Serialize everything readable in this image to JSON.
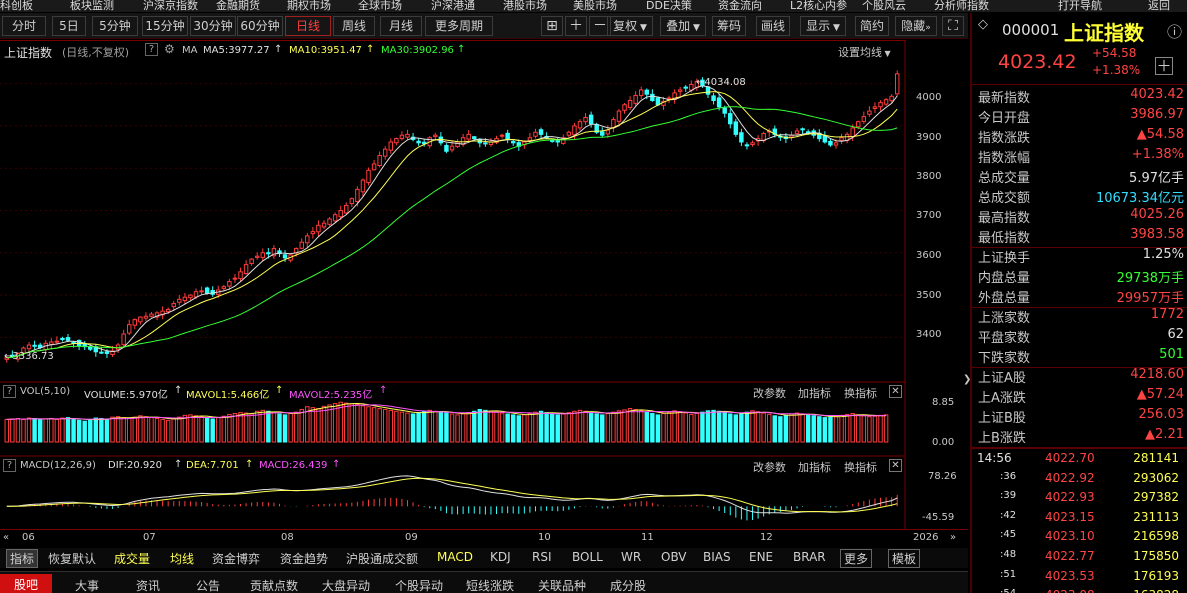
{
  "top_menu": [
    "科创板",
    "板块监测",
    "沪深京指数",
    "金融期货",
    "期权市场",
    "全球市场",
    "沪深港通",
    "港股市场",
    "美股市场",
    "DDE决策",
    "资金流向",
    "L2核心内参",
    "个股风云",
    "分析师指数",
    "打开导航",
    "返回"
  ],
  "toolbar": {
    "periods": [
      "分时",
      "5日",
      "5分钟",
      "15分钟",
      "30分钟",
      "60分钟",
      "日线",
      "周线",
      "月线",
      "更多周期"
    ],
    "selected_period": "日线",
    "actions": [
      "复权",
      "叠加",
      "筹码",
      "画线",
      "显示",
      "简约",
      "隐藏"
    ]
  },
  "chart_header": {
    "title": "上证指数",
    "subtitle": "(日线,不复权)",
    "ma_label": "MA",
    "ma5": "MA5:3977.27",
    "ma10": "MA10:3951.47",
    "ma30": "MA30:3902.96",
    "set_ma": "设置均线"
  },
  "annotations": {
    "high": "4034.08",
    "low": "3336.73"
  },
  "vol_header": {
    "name": "VOL(5,10)",
    "volume": "VOLUME:5.970亿",
    "mavol1": "MAVOL1:5.466亿",
    "mavol2": "MAVOL2:5.235亿",
    "btn1": "改参数",
    "btn2": "加指标",
    "btn3": "换指标"
  },
  "macd_header": {
    "name": "MACD(12,26,9)",
    "dif": "DIF:20.920",
    "dea": "DEA:7.701",
    "macd": "MACD:26.439",
    "btn1": "改参数",
    "btn2": "加指标",
    "btn3": "换指标"
  },
  "x_axis": [
    "06",
    "07",
    "08",
    "09",
    "10",
    "11",
    "12",
    "2026"
  ],
  "indicator_tabs": [
    "指标",
    "恢复默认",
    "成交量",
    "均线",
    "资金博弈",
    "资金趋势",
    "沪股通成交额",
    "MACD",
    "KDJ",
    "RSI",
    "BOLL",
    "WR",
    "OBV",
    "BIAS",
    "ENE",
    "BRAR",
    "更多",
    "模板"
  ],
  "bottom_tabs": [
    "股吧",
    "大事",
    "资讯",
    "公告",
    "贡献点数",
    "大盘异动",
    "个股异动",
    "短线涨跌",
    "关联品种",
    "成分股"
  ],
  "quote": {
    "code": "000001",
    "name": "上证指数",
    "price": "4023.42",
    "change": "+54.58",
    "change_pct": "+1.38%",
    "rows": [
      {
        "k": "最新指数",
        "v": "4023.42",
        "c": "red"
      },
      {
        "k": "今日开盘",
        "v": "3986.97",
        "c": "red"
      },
      {
        "k": "指数涨跌",
        "v": "▲54.58",
        "c": "red"
      },
      {
        "k": "指数涨幅",
        "v": "+1.38%",
        "c": "red"
      },
      {
        "k": "总成交量",
        "v": "5.97亿手",
        "c": "white"
      },
      {
        "k": "总成交额",
        "v": "10673.34亿元",
        "c": "cyan"
      },
      {
        "k": "最高指数",
        "v": "4025.26",
        "c": "red"
      },
      {
        "k": "最低指数",
        "v": "3983.58",
        "c": "red"
      },
      {
        "k": "上证换手",
        "v": "1.25%",
        "c": "white"
      },
      {
        "k": "内盘总量",
        "v": "29738万手",
        "c": "green"
      },
      {
        "k": "外盘总量",
        "v": "29957万手",
        "c": "red"
      },
      {
        "k": "上涨家数",
        "v": "1772",
        "c": "red"
      },
      {
        "k": "平盘家数",
        "v": "62",
        "c": "white"
      },
      {
        "k": "下跌家数",
        "v": "501",
        "c": "green"
      },
      {
        "k": "上证A股",
        "v": "4218.60",
        "c": "red"
      },
      {
        "k": "上A涨跌",
        "v": "▲57.24",
        "c": "red"
      },
      {
        "k": "上证B股",
        "v": "256.03",
        "c": "red"
      },
      {
        "k": "上B涨跌",
        "v": "▲2.21",
        "c": "red"
      }
    ],
    "ticks": [
      {
        "t": "14:56",
        "p": "4022.70",
        "v": "281141"
      },
      {
        "t": ":36",
        "p": "4022.92",
        "v": "293062"
      },
      {
        "t": ":39",
        "p": "4022.93",
        "v": "297382"
      },
      {
        "t": ":42",
        "p": "4023.15",
        "v": "231113"
      },
      {
        "t": ":45",
        "p": "4023.10",
        "v": "216598"
      },
      {
        "t": ":48",
        "p": "4022.77",
        "v": "175850"
      },
      {
        "t": ":51",
        "p": "4023.53",
        "v": "176193"
      },
      {
        "t": ":54",
        "p": "4023.08",
        "v": "163828"
      }
    ]
  },
  "chart_data": {
    "type": "candlestick",
    "title": "上证指数",
    "price_axis": [
      3400,
      3500,
      3600,
      3700,
      3800,
      3900,
      4000
    ],
    "ylim": [
      3330,
      4070
    ],
    "vol_axis": [
      "8.85",
      "0.00"
    ],
    "macd_axis": [
      "78.26",
      "-45.59"
    ],
    "close": [
      3352,
      3355,
      3362,
      3375,
      3382,
      3380,
      3376,
      3386,
      3389,
      3391,
      3395,
      3393,
      3386,
      3380,
      3378,
      3372,
      3366,
      3364,
      3362,
      3368,
      3382,
      3408,
      3430,
      3442,
      3448,
      3450,
      3455,
      3458,
      3462,
      3466,
      3480,
      3490,
      3495,
      3500,
      3508,
      3510,
      3505,
      3502,
      3512,
      3520,
      3532,
      3540,
      3555,
      3572,
      3585,
      3592,
      3600,
      3598,
      3610,
      3598,
      3588,
      3595,
      3610,
      3625,
      3640,
      3650,
      3665,
      3670,
      3680,
      3690,
      3700,
      3712,
      3728,
      3750,
      3772,
      3795,
      3810,
      3830,
      3845,
      3862,
      3870,
      3878,
      3880,
      3868,
      3860,
      3858,
      3872,
      3878,
      3860,
      3840,
      3852,
      3862,
      3872,
      3880,
      3870,
      3860,
      3858,
      3862,
      3870,
      3878,
      3868,
      3860,
      3852,
      3862,
      3872,
      3885,
      3880,
      3872,
      3865,
      3862,
      3872,
      3885,
      3900,
      3910,
      3920,
      3905,
      3885,
      3878,
      3890,
      3915,
      3935,
      3950,
      3960,
      3972,
      3985,
      3975,
      3960,
      3950,
      3958,
      3966,
      3978,
      3985,
      3990,
      3998,
      4005,
      3995,
      3975,
      3960,
      3945,
      3930,
      3905,
      3880,
      3862,
      3855,
      3860,
      3870,
      3882,
      3888,
      3880,
      3875,
      3870,
      3878,
      3888,
      3892,
      3885,
      3878,
      3870,
      3862,
      3855,
      3860,
      3872,
      3880,
      3895,
      3910,
      3922,
      3935,
      3945,
      3955,
      3962,
      3970,
      4023
    ],
    "vol": [
      5.0,
      5.1,
      5.2,
      5.0,
      5.3,
      5.2,
      4.9,
      5.1,
      5.2,
      5.0,
      5.3,
      5.4,
      5.1,
      4.8,
      4.6,
      5.0,
      5.3,
      5.2,
      5.1,
      5.5,
      5.6,
      5.4,
      5.2,
      5.5,
      5.8,
      5.6,
      5.4,
      5.2,
      5.0,
      4.8,
      5.1,
      5.5,
      5.9,
      6.0,
      5.8,
      5.6,
      5.3,
      5.1,
      5.4,
      5.7,
      6.1,
      6.3,
      6.5,
      6.4,
      6.2,
      6.8,
      7.0,
      6.8,
      6.5,
      6.2,
      6.0,
      6.3,
      6.6,
      7.2,
      7.8,
      7.6,
      7.4,
      7.9,
      8.2,
      8.5,
      8.8,
      8.6,
      8.4,
      8.3,
      8.0,
      7.8,
      7.6,
      7.4,
      7.2,
      7.0,
      6.8,
      6.6,
      6.4,
      6.2,
      6.5,
      6.8,
      7.0,
      6.8,
      6.6,
      6.4,
      6.2,
      6.0,
      6.2,
      6.5,
      6.8,
      7.2,
      7.0,
      6.8,
      6.6,
      6.4,
      6.2,
      6.0,
      5.8,
      6.0,
      6.3,
      6.6,
      6.8,
      6.5,
      6.2,
      6.0,
      6.2,
      6.5,
      6.8,
      7.0,
      6.8,
      6.5,
      6.2,
      6.0,
      6.3,
      6.6,
      6.9,
      7.1,
      7.4,
      7.2,
      6.9,
      6.6,
      6.3,
      6.0,
      6.3,
      6.6,
      6.9,
      6.7,
      6.4,
      6.1,
      6.3,
      6.6,
      6.9,
      7.0,
      6.8,
      6.5,
      6.2,
      6.0,
      6.3,
      6.6,
      6.9,
      6.7,
      6.4,
      6.1,
      5.8,
      5.6,
      5.9,
      6.2,
      6.4,
      6.2,
      6.0,
      5.8,
      5.6,
      5.4,
      5.5,
      5.7,
      5.9,
      6.1,
      6.3,
      6.0,
      5.8,
      5.6,
      5.7,
      5.9,
      6.0
    ]
  }
}
